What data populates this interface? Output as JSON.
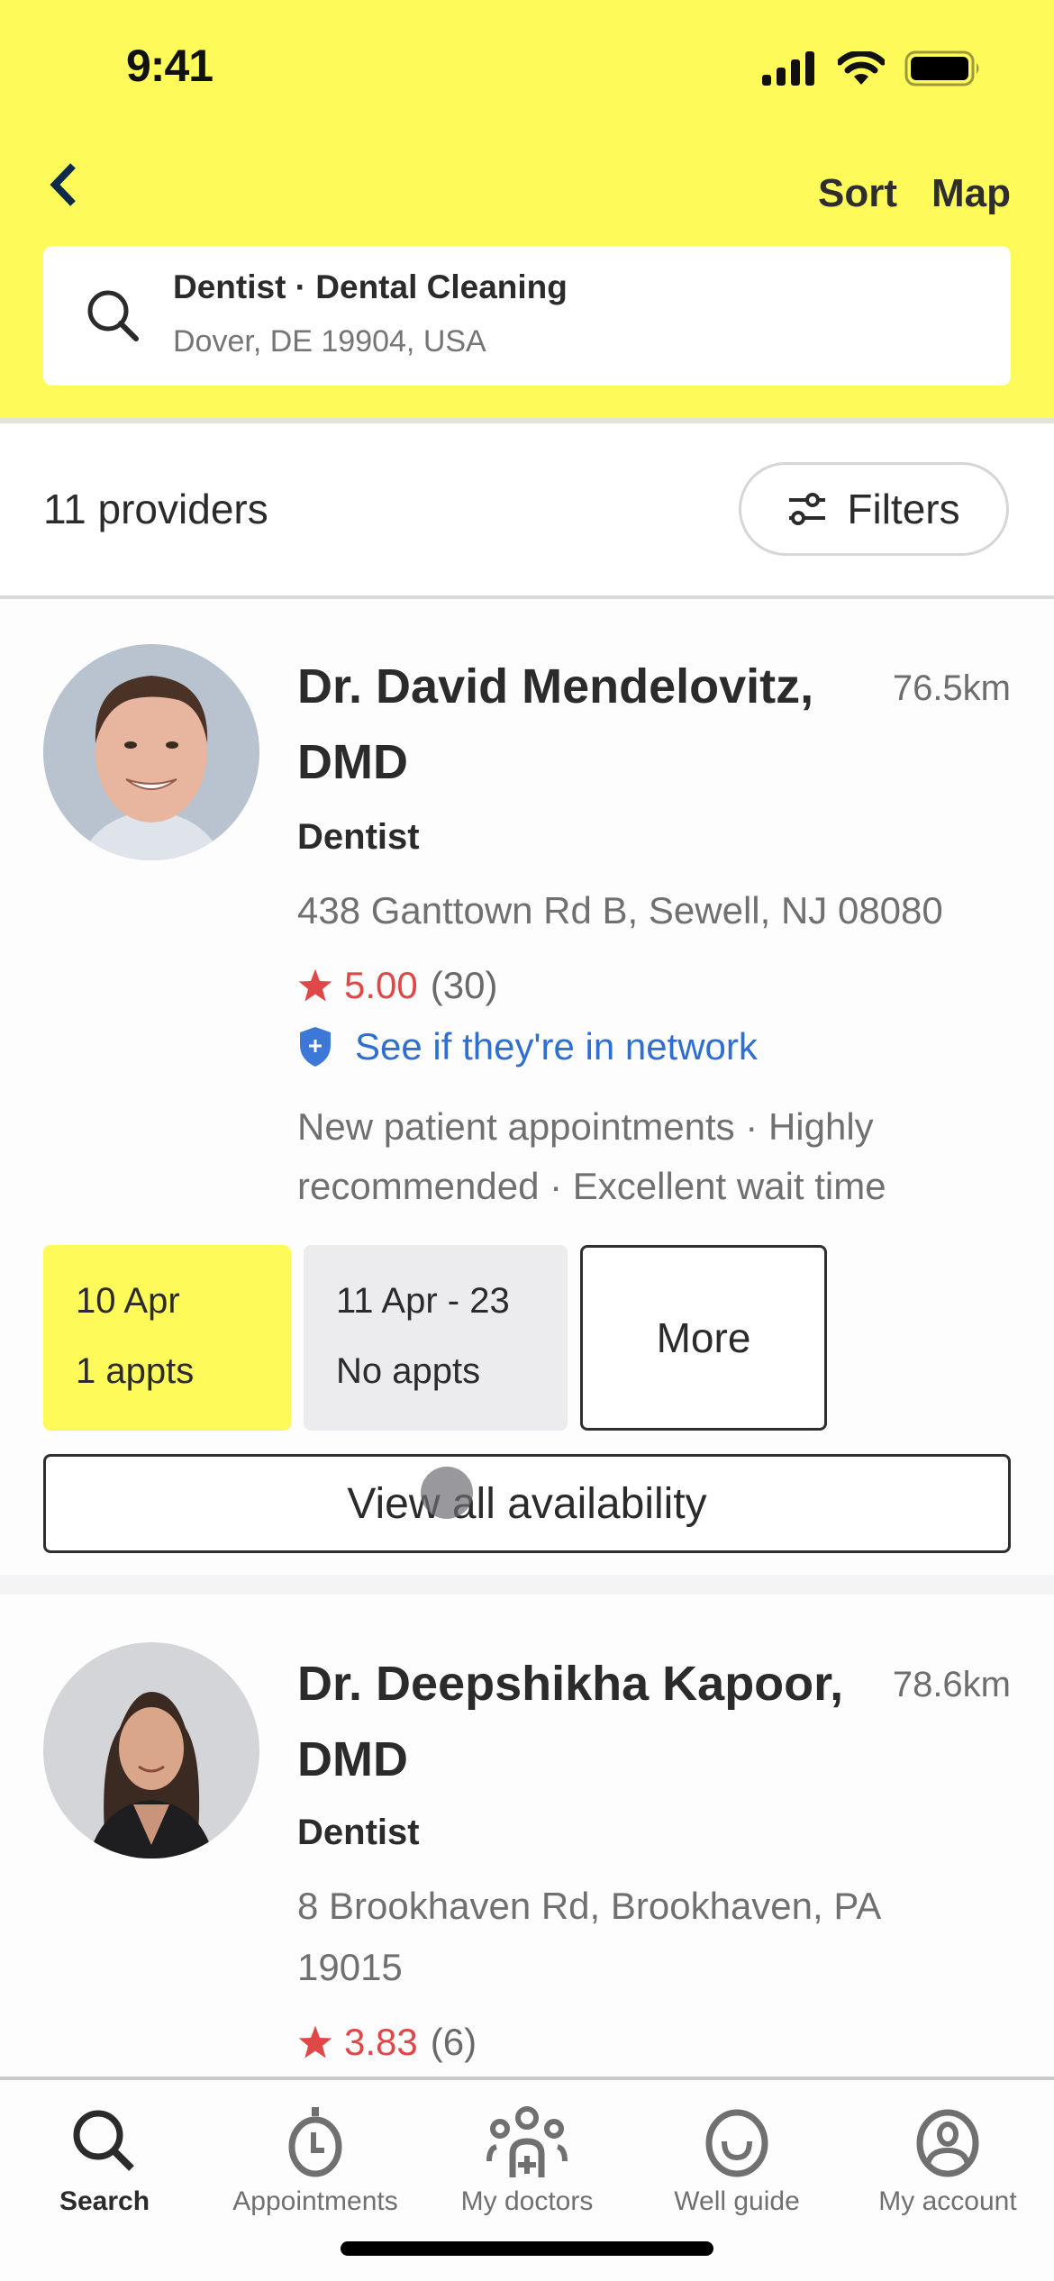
{
  "status_bar": {
    "time": "9:41"
  },
  "header": {
    "back_label": "Back",
    "sort_label": "Sort",
    "map_label": "Map",
    "search": {
      "query": "Dentist · Dental Cleaning",
      "location": "Dover, DE 19904, USA"
    },
    "accent_color": "#fefa5a"
  },
  "results": {
    "count_label": "11 providers",
    "filters_label": "Filters"
  },
  "providers": [
    {
      "name": "Dr. David Mendelovitz, DMD",
      "distance": "76.5km",
      "specialty": "Dentist",
      "address": "438 Ganttown Rd B, Sewell, NJ 08080",
      "rating": "5.00",
      "review_count": "(30)",
      "network_link": "See if they're in network",
      "tags": "New patient appointments · Highly recommended · Excellent wait time",
      "slots": [
        {
          "date": "10 Apr",
          "appts": "1 appts",
          "highlighted": true
        },
        {
          "date": "11 Apr - 23",
          "appts": "No appts",
          "highlighted": false
        }
      ],
      "more_label": "More",
      "view_all_label": "View all availability"
    },
    {
      "name": "Dr. Deepshikha Kapoor, DMD",
      "distance": "78.6km",
      "specialty": "Dentist",
      "address": "8 Brookhaven Rd, Brookhaven, PA 19015",
      "rating": "3.83",
      "review_count": "(6)"
    }
  ],
  "tabbar": {
    "items": [
      {
        "label": "Search",
        "icon": "search-icon",
        "active": true
      },
      {
        "label": "Appointments",
        "icon": "stopwatch-icon",
        "active": false
      },
      {
        "label": "My doctors",
        "icon": "doctors-group-icon",
        "active": false
      },
      {
        "label": "Well guide",
        "icon": "smile-icon",
        "active": false
      },
      {
        "label": "My account",
        "icon": "account-icon",
        "active": false
      }
    ]
  },
  "colors": {
    "rating": "#e04848",
    "link": "#2f6fd0",
    "unavailable_slot": "#ecebee"
  }
}
